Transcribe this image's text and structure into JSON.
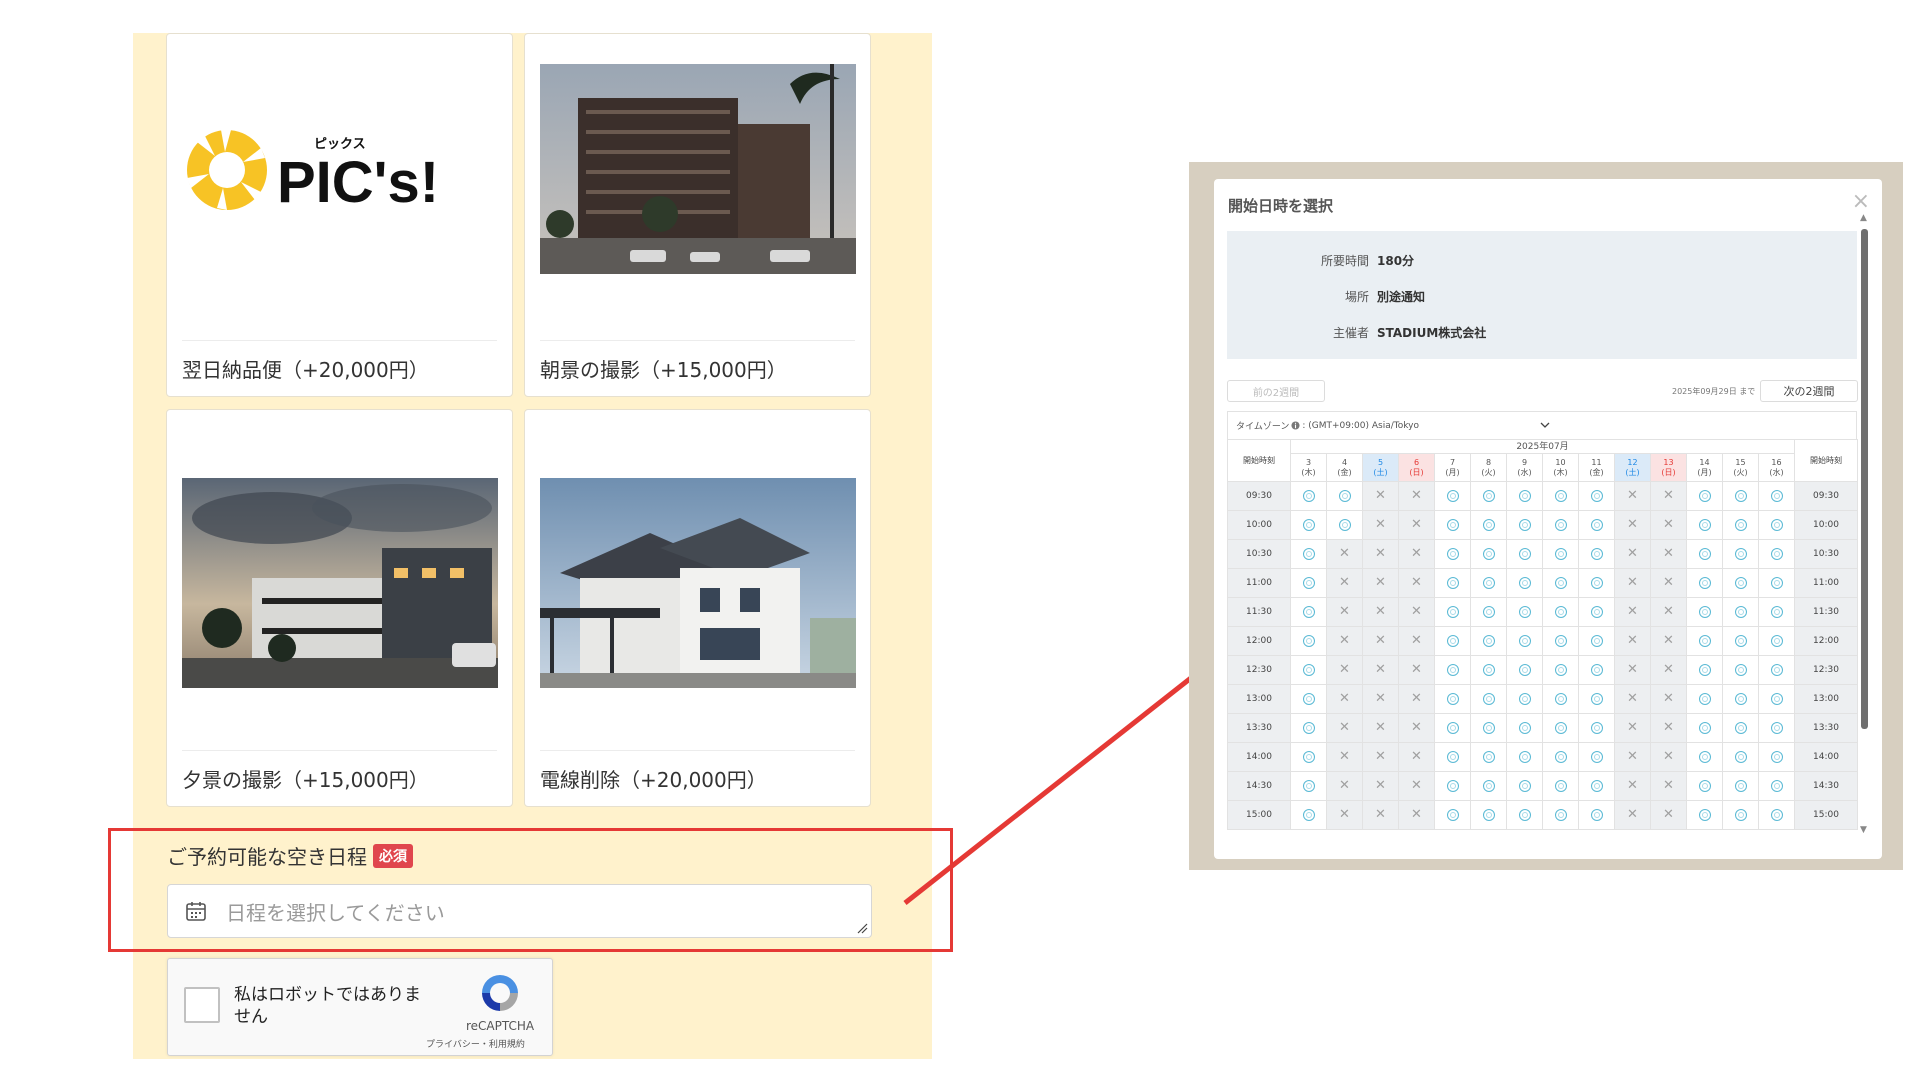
{
  "cards": [
    {
      "label": "翌日納品便（+20,000円）",
      "logo_text": "PIC's!",
      "logo_kana": "ピックス"
    },
    {
      "label": "朝景の撮影（+15,000円）"
    },
    {
      "label": "夕景の撮影（+15,000円）"
    },
    {
      "label": "電線削除（+20,000円）"
    }
  ],
  "schedule": {
    "title": "ご予約可能な空き日程",
    "required": "必須",
    "placeholder": "日程を選択してください"
  },
  "captcha": {
    "text": "私はロボットではありません",
    "brand": "reCAPTCHA",
    "links": "プライバシー・利用規約"
  },
  "modal": {
    "title": "開始日時を選択",
    "close": "×",
    "info": [
      {
        "key": "所要時間",
        "value": "180分"
      },
      {
        "key": "場所",
        "value": "別途通知"
      },
      {
        "key": "主催者",
        "value": "STADIUM株式会社"
      }
    ],
    "prev_button": "前の2週間",
    "until_text": "2025年09月29日 まで",
    "next_button": "次の2週間",
    "timezone": "タイムゾーン",
    "timezone_value": ": (GMT+09:00) Asia/Tokyo",
    "month": "2025年07月",
    "time_header": "開始時刻",
    "days": [
      {
        "d": "3",
        "w": "(木)",
        "type": ""
      },
      {
        "d": "4",
        "w": "(金)",
        "type": ""
      },
      {
        "d": "5",
        "w": "(土)",
        "type": "sat"
      },
      {
        "d": "6",
        "w": "(日)",
        "type": "sun"
      },
      {
        "d": "7",
        "w": "(月)",
        "type": ""
      },
      {
        "d": "8",
        "w": "(火)",
        "type": ""
      },
      {
        "d": "9",
        "w": "(水)",
        "type": ""
      },
      {
        "d": "10",
        "w": "(木)",
        "type": ""
      },
      {
        "d": "11",
        "w": "(金)",
        "type": ""
      },
      {
        "d": "12",
        "w": "(土)",
        "type": "sat"
      },
      {
        "d": "13",
        "w": "(日)",
        "type": "sun"
      },
      {
        "d": "14",
        "w": "(月)",
        "type": ""
      },
      {
        "d": "15",
        "w": "(火)",
        "type": ""
      },
      {
        "d": "16",
        "w": "(水)",
        "type": ""
      }
    ],
    "times": [
      "09:30",
      "10:00",
      "10:30",
      "11:00",
      "11:30",
      "12:00",
      "12:30",
      "13:00",
      "13:30",
      "14:00",
      "14:30",
      "15:00"
    ],
    "availability": [
      "OOXXOOOOOXXOOO",
      "OOXXOOOOOXXOOO",
      "OXXXOOOOOXXOOO",
      "OXXXOOOOOXXOOO",
      "OXXXOOOOOXXOOO",
      "OXXXOOOOOXXOOO",
      "OXXXOOOOOXXOOO",
      "OXXXOOOOOXXOOO",
      "OXXXOOOOOXXOOO",
      "OXXXOOOOOXXOOO",
      "OXXXOOOOOXXOOO",
      "OXXXOOOOOXXOOO"
    ],
    "footer": "プライバシー・利用規約"
  },
  "colors": {
    "panel_bg": "#fff2cc",
    "highlight": "#e53935",
    "required_badge": "#e0464d",
    "saturday": "#1e88e5",
    "sunday": "#e53935"
  }
}
